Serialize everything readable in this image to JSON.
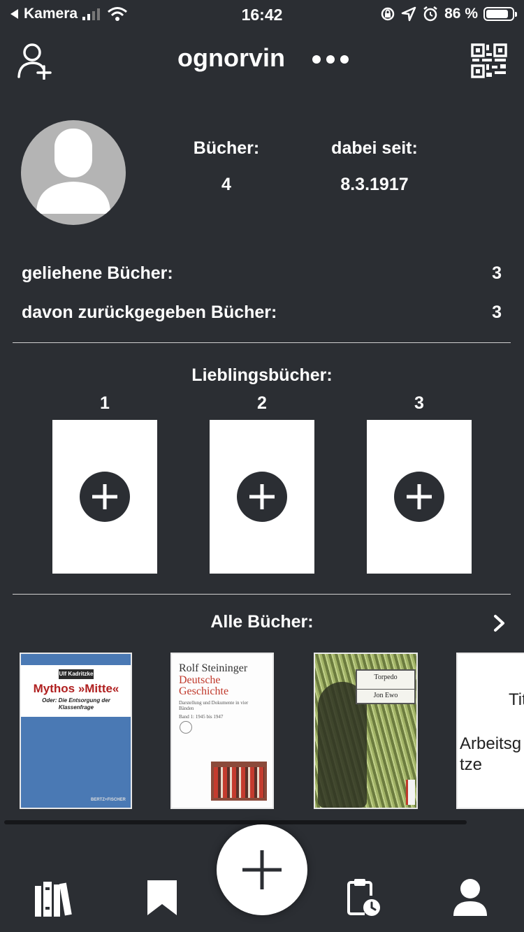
{
  "status_bar": {
    "back_app": "Kamera",
    "time": "16:42",
    "battery_percent": "86 %",
    "battery_level": 0.86
  },
  "header": {
    "username": "ognorvin"
  },
  "profile": {
    "books_label": "Bücher:",
    "books_value": "4",
    "since_label": "dabei seit:",
    "since_value": "8.3.1917",
    "borrowed_label": "geliehene Bücher:",
    "borrowed_value": "3",
    "returned_label": "davon zurückgegeben Bücher:",
    "returned_value": "3"
  },
  "favorites": {
    "title": "Lieblingsbücher:",
    "slots": [
      {
        "number": "1"
      },
      {
        "number": "2"
      },
      {
        "number": "3"
      }
    ]
  },
  "all_books": {
    "title": "Alle Bücher:",
    "books": [
      {
        "author": "Ulf Kadritzke",
        "title": "Mythos »Mitte«",
        "subtitle": "Oder: Die Entsorgung der Klassenfrage",
        "publisher": "BERTZ+FISCHER"
      },
      {
        "author": "Rolf Steininger",
        "title": "Deutsche Geschichte",
        "subtitle": "Darstellung und Dokumente in vier Bänden",
        "volume": "Band 1: 1945 bis 1947"
      },
      {
        "title": "Torpedo",
        "author": "Jon Ewo"
      },
      {
        "line1": "Titel",
        "line2": "Arbeitsg",
        "line3": "tze"
      }
    ]
  },
  "colors": {
    "background": "#2b2e33",
    "text": "#ffffff",
    "avatar": "#b4b4b4",
    "card": "#ffffff"
  },
  "tabbar": {
    "items": [
      "library-icon",
      "bookmark-icon",
      "add-icon",
      "clipboard-clock-icon",
      "profile-icon"
    ]
  }
}
